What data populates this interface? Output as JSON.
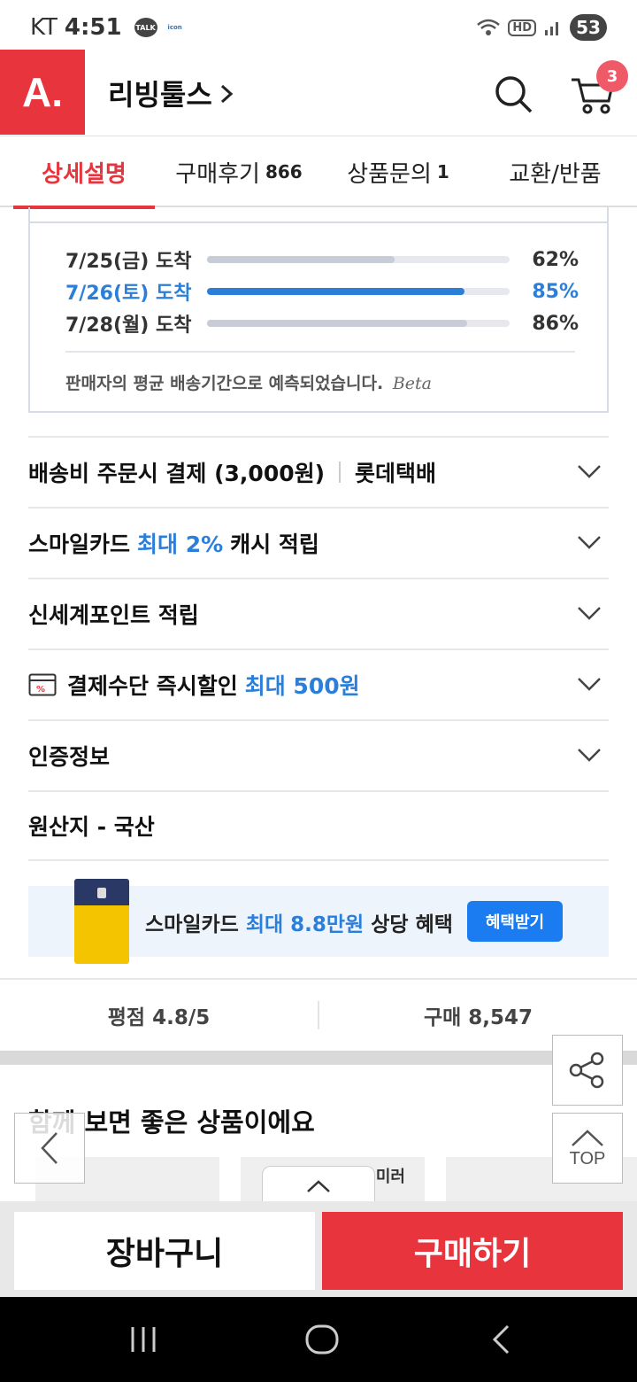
{
  "status_bar": {
    "carrier": "KT",
    "time": "4:51",
    "talk_icon_label": "TALK",
    "icon_app_label": "icon",
    "hd_label": "HD",
    "battery": "53"
  },
  "header": {
    "logo": "A.",
    "store_name": "리빙툴스",
    "cart_count": "3"
  },
  "tabs": [
    {
      "label": "상세설명",
      "count": ""
    },
    {
      "label": "구매후기",
      "count": "866"
    },
    {
      "label": "상품문의",
      "count": "1"
    },
    {
      "label": "교환/반품",
      "count": ""
    }
  ],
  "delivery_estimate": {
    "rows": [
      {
        "label": "7/25(금) 도착",
        "percent_text": "62%",
        "value": 0.62
      },
      {
        "label": "7/26(토) 도착",
        "percent_text": "85%",
        "value": 0.85
      },
      {
        "label": "7/28(월) 도착",
        "percent_text": "86%",
        "value": 0.86
      }
    ],
    "note": "판매자의 평균 배송기간으로 예측되었습니다.",
    "beta": "Beta"
  },
  "info": {
    "shipping": {
      "label": "배송비 주문시 결제 (3,000원)",
      "carrier": "롯데택배"
    },
    "smilecard": {
      "prefix": "스마일카드",
      "highlight": "최대 2%",
      "suffix": "캐시 적립"
    },
    "points": {
      "label": "신세계포인트 적립"
    },
    "discount": {
      "prefix": "결제수단 즉시할인",
      "highlight": "최대 500원"
    },
    "certification": {
      "label": "인증정보"
    },
    "origin": {
      "label": "원산지 - 국산"
    }
  },
  "promo": {
    "prefix": "스마일카드",
    "highlight": "최대 8.8만원",
    "suffix": "상당 혜택",
    "button": "혜택받기"
  },
  "stats": {
    "rating": "평점 4.8/5",
    "purchases": "구매 8,547"
  },
  "recommend": {
    "title": "함께 보면 좋은 상품이에요",
    "card2_text": "미러"
  },
  "floating": {
    "top_label": "TOP"
  },
  "bottom": {
    "cart_button": "장바구니",
    "buy_button": "구매하기"
  }
}
